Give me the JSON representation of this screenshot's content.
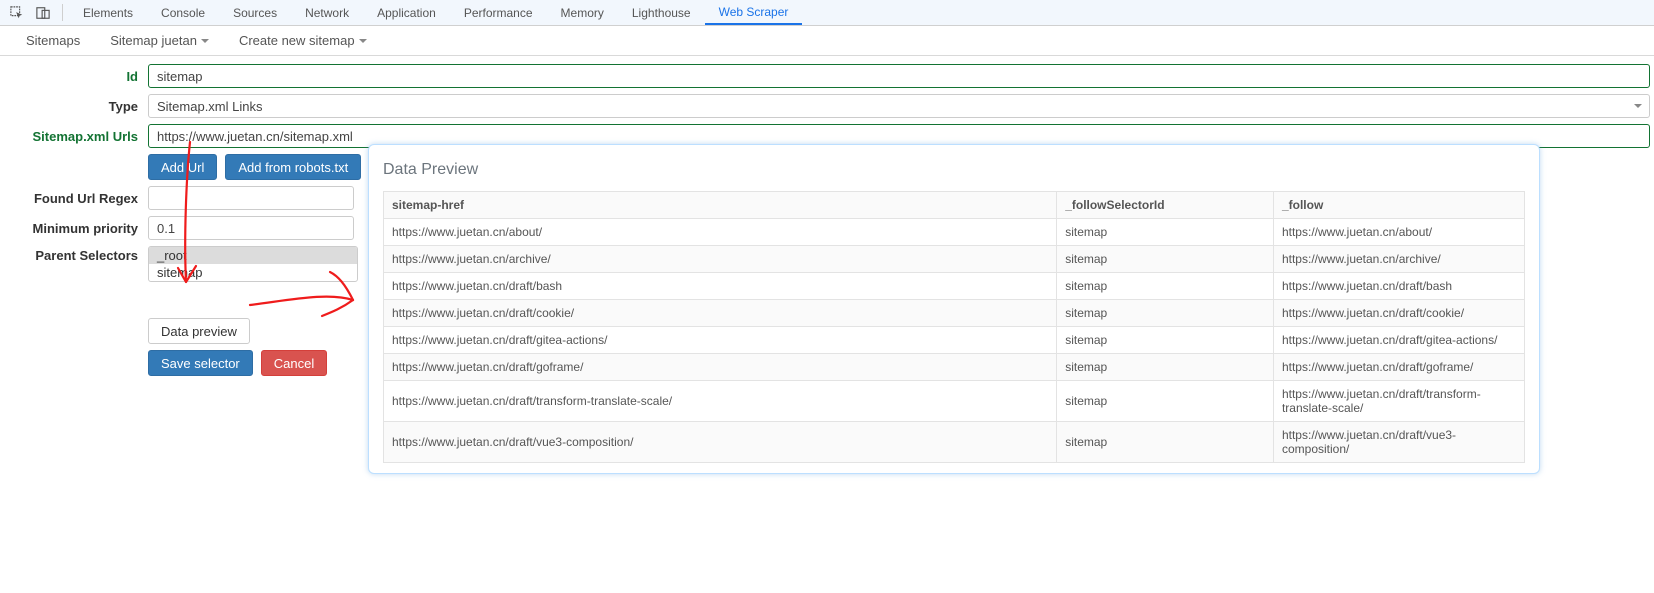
{
  "devtools_tabs": [
    "Elements",
    "Console",
    "Sources",
    "Network",
    "Application",
    "Performance",
    "Memory",
    "Lighthouse",
    "Web Scraper"
  ],
  "devtools_active_index": 8,
  "sub_toolbar": {
    "sitemaps": "Sitemaps",
    "sitemap_current": "Sitemap juetan",
    "create": "Create new sitemap"
  },
  "form": {
    "labels": {
      "id": "Id",
      "type": "Type",
      "urls": "Sitemap.xml Urls",
      "regex": "Found Url Regex",
      "priority": "Minimum priority",
      "parent": "Parent Selectors"
    },
    "values": {
      "id": "sitemap",
      "type": "Sitemap.xml Links",
      "url": "https://www.juetan.cn/sitemap.xml",
      "regex": "",
      "priority": "0.1"
    },
    "buttons": {
      "add_url": "Add Url",
      "add_robots": "Add from robots.txt",
      "data_preview": "Data preview",
      "save": "Save selector",
      "cancel": "Cancel"
    },
    "parent_options": [
      "_root",
      "sitemap"
    ],
    "parent_selected_index": 0
  },
  "popover": {
    "title": "Data Preview",
    "columns": [
      "sitemap-href",
      "_followSelectorId",
      "_follow"
    ],
    "rows": [
      {
        "href": "https://www.juetan.cn/about/",
        "sel": "sitemap",
        "follow": "https://www.juetan.cn/about/"
      },
      {
        "href": "https://www.juetan.cn/archive/",
        "sel": "sitemap",
        "follow": "https://www.juetan.cn/archive/"
      },
      {
        "href": "https://www.juetan.cn/draft/bash",
        "sel": "sitemap",
        "follow": "https://www.juetan.cn/draft/bash"
      },
      {
        "href": "https://www.juetan.cn/draft/cookie/",
        "sel": "sitemap",
        "follow": "https://www.juetan.cn/draft/cookie/"
      },
      {
        "href": "https://www.juetan.cn/draft/gitea-actions/",
        "sel": "sitemap",
        "follow": "https://www.juetan.cn/draft/gitea-actions/"
      },
      {
        "href": "https://www.juetan.cn/draft/goframe/",
        "sel": "sitemap",
        "follow": "https://www.juetan.cn/draft/goframe/"
      },
      {
        "href": "https://www.juetan.cn/draft/transform-translate-scale/",
        "sel": "sitemap",
        "follow": "https://www.juetan.cn/draft/transform-translate-scale/"
      },
      {
        "href": "https://www.juetan.cn/draft/vue3-composition/",
        "sel": "sitemap",
        "follow": "https://www.juetan.cn/draft/vue3-composition/"
      }
    ]
  }
}
